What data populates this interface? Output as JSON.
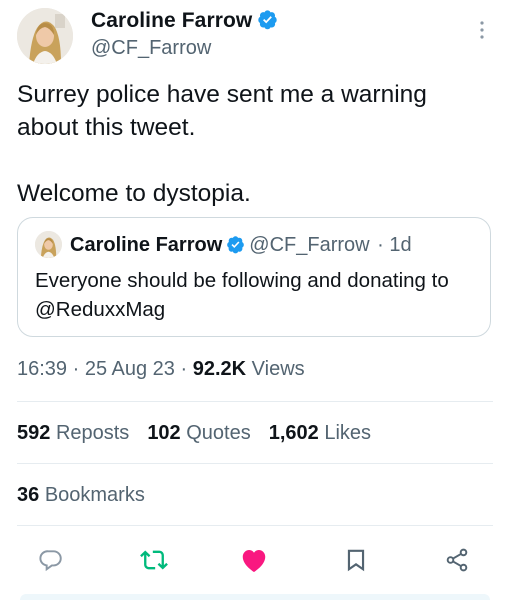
{
  "author": {
    "name": "Caroline Farrow",
    "handle": "@CF_Farrow"
  },
  "tweet": {
    "line1": "Surrey police have sent me a warning about this tweet.",
    "line2": "Welcome to dystopia."
  },
  "quoted": {
    "name": "Caroline Farrow",
    "handle": "@CF_Farrow",
    "age": "· 1d",
    "text": "Everyone should be following and donating to @ReduxxMag"
  },
  "meta": {
    "time": "16:39",
    "date": "· 25 Aug 23 ·",
    "views_count": "92.2K",
    "views_label": "Views"
  },
  "stats": {
    "reposts_count": "592",
    "reposts_label": "Reposts",
    "quotes_count": "102",
    "quotes_label": "Quotes",
    "likes_count": "1,602",
    "likes_label": "Likes"
  },
  "bookmarks": {
    "count": "36",
    "label": "Bookmarks"
  },
  "colors": {
    "verified": "#1d9bf0",
    "repost": "#00ba7c",
    "like": "#f91880",
    "secondary_text": "#536471"
  },
  "icons": [
    "verified-badge-icon",
    "more-options-icon",
    "reply-icon",
    "repost-icon",
    "like-icon",
    "bookmark-icon",
    "share-icon"
  ]
}
